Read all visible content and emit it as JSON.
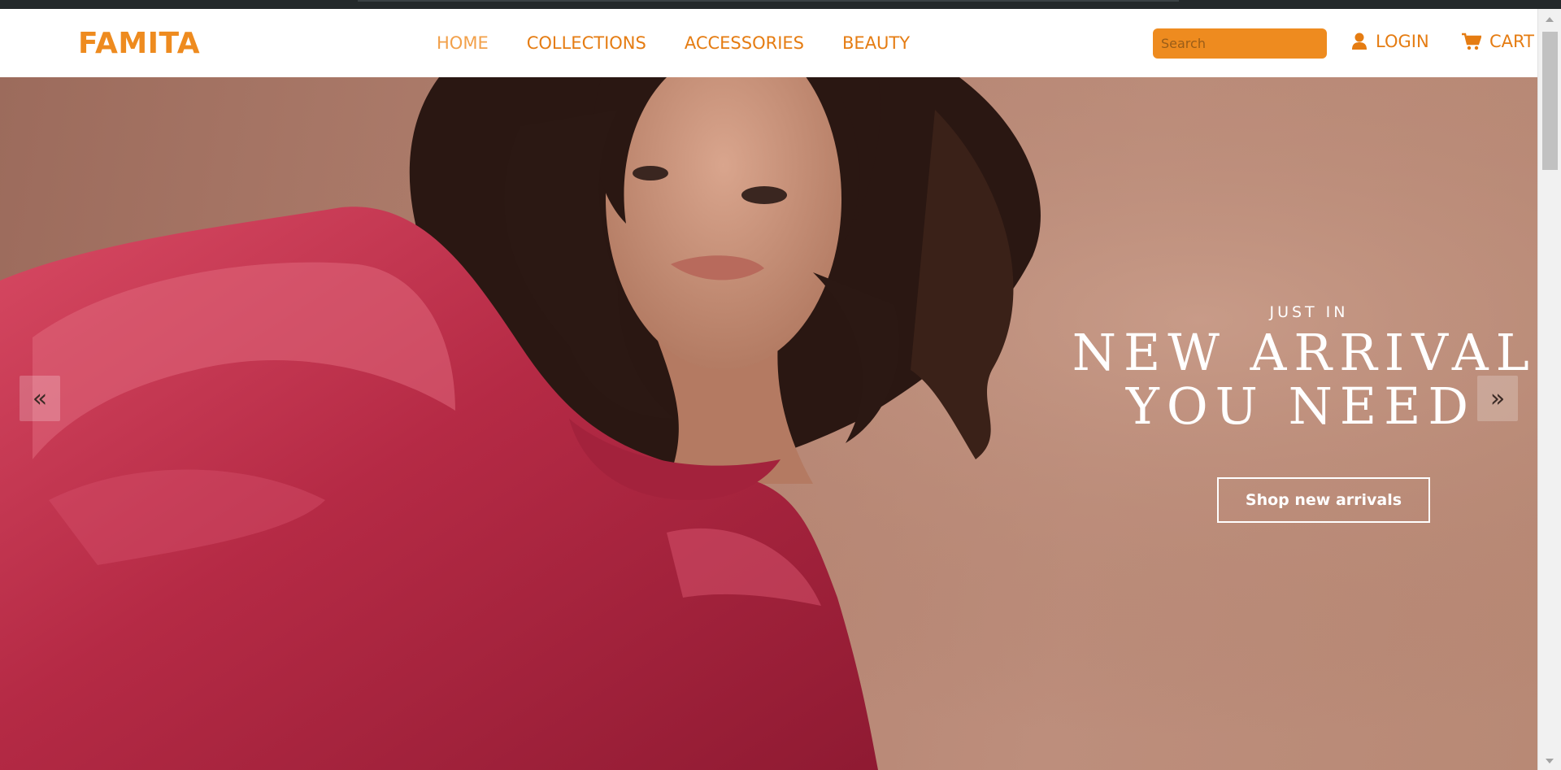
{
  "brand": {
    "name": "FAMITA",
    "accent_color": "#ee8b1f"
  },
  "nav": {
    "items": [
      {
        "label": "HOME",
        "active": true
      },
      {
        "label": "COLLECTIONS",
        "active": false
      },
      {
        "label": "ACCESSORIES",
        "active": false
      },
      {
        "label": "BEAUTY",
        "active": false
      }
    ]
  },
  "search": {
    "placeholder": "Search",
    "value": ""
  },
  "account": {
    "login_label": "LOGIN",
    "login_icon": "user-icon",
    "cart_label": "CART",
    "cart_icon": "cart-icon"
  },
  "hero": {
    "kicker": "JUST IN",
    "headline_line1": "NEW ARRIVALS",
    "headline_line2": "YOU NEED",
    "cta_label": "Shop new arrivals",
    "prev_label": "«",
    "next_label": "»",
    "background_color": "#b58472",
    "dress_color": "#b52a45"
  }
}
